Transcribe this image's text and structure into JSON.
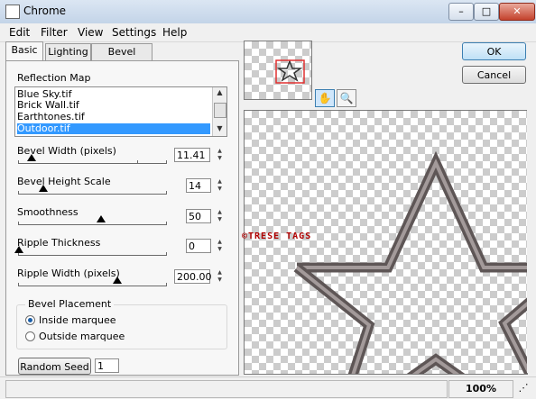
{
  "window": {
    "title": "Chrome",
    "controls": {
      "minimize": "–",
      "maximize": "□",
      "close": "✕"
    }
  },
  "menu": {
    "edit": "Edit",
    "filter": "Filter",
    "view": "View",
    "settings": "Settings",
    "help": "Help"
  },
  "tabs": {
    "basic": "Basic",
    "lighting": "Lighting",
    "bevel_profile": "Bevel Profile"
  },
  "reflection_map": {
    "label": "Reflection Map",
    "items": [
      "Blue Sky.tif",
      "Brick Wall.tif",
      "Earthtones.tif",
      "Outdoor.tif"
    ],
    "selected": "Outdoor.tif"
  },
  "params": {
    "bevel_width": {
      "label": "Bevel Width (pixels)",
      "value": "11.41"
    },
    "bevel_height_scale": {
      "label": "Bevel Height Scale",
      "value": "14"
    },
    "smoothness": {
      "label": "Smoothness",
      "value": "50"
    },
    "ripple_thickness": {
      "label": "Ripple Thickness",
      "value": "0"
    },
    "ripple_width": {
      "label": "Ripple Width (pixels)",
      "value": "200.00"
    }
  },
  "bevel_placement": {
    "label": "Bevel Placement",
    "inside": "Inside marquee",
    "outside": "Outside marquee",
    "selected": "inside"
  },
  "random_seed": {
    "button": "Random Seed",
    "value": "1"
  },
  "dialog_buttons": {
    "ok": "OK",
    "cancel": "Cancel"
  },
  "tools": {
    "hand": "hand-icon",
    "zoom": "magnifier-icon"
  },
  "watermark": "©TRESE TAGS",
  "status": {
    "zoom": "100%"
  },
  "colors": {
    "selection": "#3399ff",
    "accent": "#3c7fb1",
    "watermark": "#b00000",
    "bevel": "#6a6060"
  }
}
